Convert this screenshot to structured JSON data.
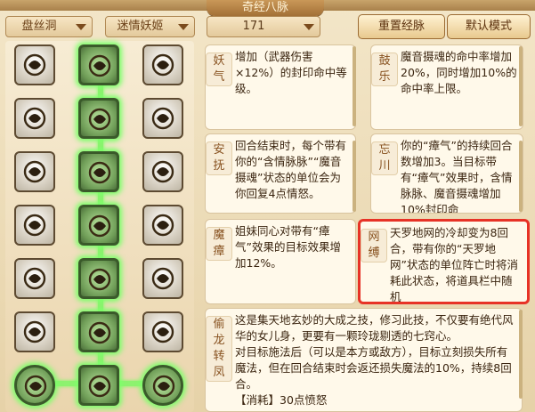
{
  "window": {
    "title": "奇经八脉"
  },
  "filters": {
    "faction": "盘丝洞",
    "school": "迷情妖姬",
    "points": "171"
  },
  "buttons": {
    "reset": "重置经脉",
    "default": "默认模式"
  },
  "skills": {
    "col1": [
      "grab-icon",
      "flame-icon",
      "web-shell-icon",
      "swirl-icon",
      "hammer-icon",
      "eye-icon",
      "dragon-ball-icon"
    ],
    "col2": [
      "vial-icon",
      "coil-icon",
      "spider-icon",
      "dagger-web-icon",
      "hex-web-icon",
      "web-cross-icon",
      "dragon-icon"
    ],
    "col3": [
      "knot-icon",
      "scroll-icon",
      "wings-icon",
      "rings-icon",
      "figure-icon",
      "blade-icon",
      "dragon-ball-icon"
    ]
  },
  "cards": [
    {
      "name": "妖气",
      "desc": "增加（武器伤害×12%）的封印命中等级。"
    },
    {
      "name": "鼓乐",
      "desc": "魔音摄魂的命中率增加20%，同时增加10%的命中率上限。"
    },
    {
      "name": "安抚",
      "desc": "回合结束时，每个带有你的“含情脉脉”“魔音摄魂”状态的单位会为你回复4点情怒。"
    },
    {
      "name": "忘川",
      "desc": "你的“瘴气”的持续回合数增加3。当目标带有“瘴气”效果时，含情脉脉、魔音摄魂增加10%封印命"
    },
    {
      "name": "魔瘴",
      "desc": "姐妹同心对带有“瘴气”效果的目标效果增加12%。"
    },
    {
      "name": "网缚",
      "desc": "天罗地网的冷却变为8回合，带有你的“天罗地网”状态的单位阵亡时将消耗此状态，将道具栏中随机"
    },
    {
      "name": "偷龙转凤",
      "desc": "这是集天地玄妙的大成之技，修习此技，不仅要有绝代风华的女儿身，更要有一颗玲珑剔透的七窍心。\n对目标施法后（可以是本方或敌方），目标立刻损失所有魔法，但在回合结束时会返还损失魔法的10%，持续8回合。\n【消耗】30点愤怒"
    }
  ]
}
